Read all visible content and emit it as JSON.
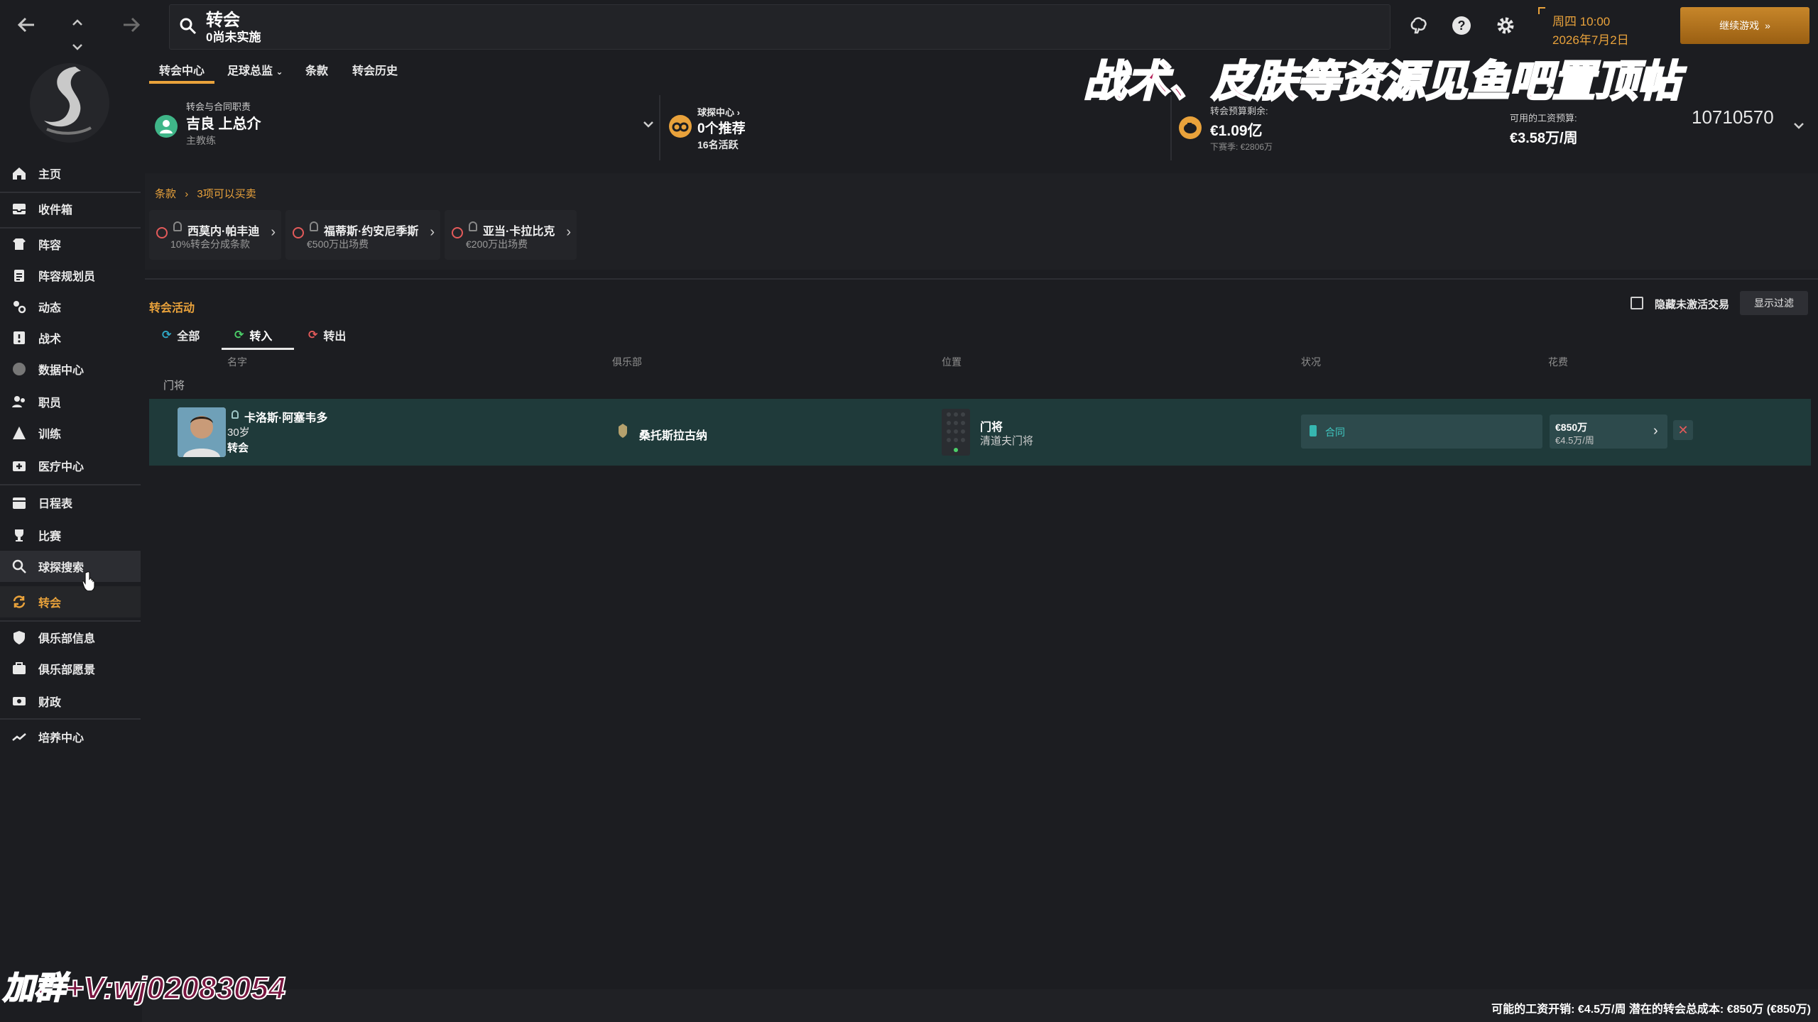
{
  "window": {
    "title": "转会",
    "subtitle": "0尚未实施",
    "date_day": "周四 10:00",
    "date_full": "2026年7月2日",
    "continue_label": "继续游戏"
  },
  "sidebar": {
    "items": [
      {
        "label": "主页",
        "icon": "home-icon"
      },
      {
        "label": "收件箱",
        "icon": "inbox-icon"
      },
      {
        "label": "阵容",
        "icon": "squad-icon"
      },
      {
        "label": "阵容规划员",
        "icon": "clipboard-icon"
      },
      {
        "label": "动态",
        "icon": "dynamics-icon"
      },
      {
        "label": "战术",
        "icon": "tactics-icon"
      },
      {
        "label": "数据中心",
        "icon": "data-icon"
      },
      {
        "label": "职员",
        "icon": "staff-icon"
      },
      {
        "label": "训练",
        "icon": "training-icon"
      },
      {
        "label": "医疗中心",
        "icon": "medical-icon"
      },
      {
        "label": "日程表",
        "icon": "calendar-icon"
      },
      {
        "label": "比赛",
        "icon": "trophy-icon"
      },
      {
        "label": "球探搜索",
        "icon": "search-icon"
      },
      {
        "label": "转会",
        "icon": "transfer-icon"
      },
      {
        "label": "俱乐部信息",
        "icon": "shield-icon"
      },
      {
        "label": "俱乐部愿景",
        "icon": "vision-icon"
      },
      {
        "label": "财政",
        "icon": "finance-icon"
      },
      {
        "label": "培养中心",
        "icon": "development-icon"
      }
    ]
  },
  "tabs": [
    {
      "label": "转会中心"
    },
    {
      "label": "足球总监"
    },
    {
      "label": "条款"
    },
    {
      "label": "转会历史"
    }
  ],
  "staff": {
    "role_label": "转会与合同职责",
    "name": "吉良 上总介",
    "title": "主教练"
  },
  "scout": {
    "label": "球探中心",
    "recommend": "0个推荐",
    "active": "16名活跃"
  },
  "budget": {
    "label": "转会预算剩余:",
    "value": "€1.09亿",
    "next_season": "下赛季: €2806万",
    "wage_label": "可用的工资预算:",
    "wage_value": "€3.58万/周",
    "right_number": "10710570"
  },
  "clauses": {
    "crumb_root": "条款",
    "crumb_current": "3项可以买卖",
    "items": [
      {
        "name": "西莫内·帕丰迪",
        "desc": "10%转会分成条款"
      },
      {
        "name": "福蒂斯·约安尼季斯",
        "desc": "€500万出场费"
      },
      {
        "name": "亚当·卡拉比克",
        "desc": "€200万出场费"
      }
    ]
  },
  "activity": {
    "title": "转会活动",
    "hide_inactive_label": "隐藏未激活交易",
    "show_filter_label": "显示过滤",
    "filters": [
      {
        "label": "全部"
      },
      {
        "label": "转入"
      },
      {
        "label": "转出"
      }
    ],
    "columns": {
      "name": "名字",
      "club": "俱乐部",
      "position": "位置",
      "status": "状况",
      "fee": "花费"
    },
    "group_label": "门将",
    "rows": [
      {
        "name": "卡洛斯·阿塞韦多",
        "age": "30岁",
        "type": "转会",
        "club": "桑托斯拉古纳",
        "position": "门将",
        "role": "清道夫门将",
        "status": "合同",
        "fee": "€850万",
        "wage": "€4.5万/周"
      }
    ]
  },
  "footer": {
    "summary": "可能的工资开销: €4.5万/周 潜在的转会总成本: €850万 (€850万)"
  },
  "overlays": {
    "banner": "战术、皮肤等资源见鱼吧置顶帖",
    "contact": "加群+V:wj02083054"
  }
}
